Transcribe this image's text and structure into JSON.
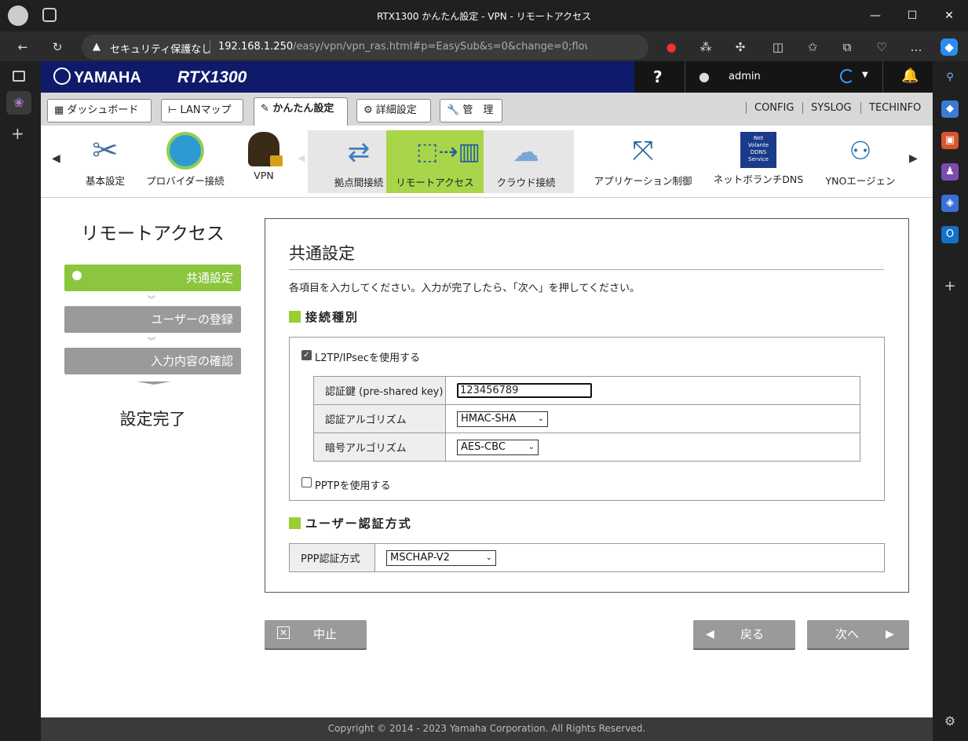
{
  "window": {
    "title": "RTX1300 かんたん設定 - VPN - リモートアクセス",
    "minimize": "—",
    "maximize": "☐",
    "close": "✕"
  },
  "browser": {
    "security_label": "セキュリティ保護なし",
    "url_host": "192.168.1.250",
    "url_path": "/easy/vpn/vpn_ras.html#p=EasySub&s=0&change=0;flow_..."
  },
  "header": {
    "logo": "YAMAHA",
    "model": "RTX1300",
    "help": "?",
    "user": "admin"
  },
  "tabs": [
    {
      "label": "ダッシュボード"
    },
    {
      "label": "LANマップ"
    },
    {
      "label": "かんたん設定"
    },
    {
      "label": "詳細設定"
    },
    {
      "label": "管　理"
    }
  ],
  "top_links": [
    "CONFIG",
    "SYSLOG",
    "TECHINFO"
  ],
  "icon_menu": [
    {
      "label": "基本設定"
    },
    {
      "label": "プロバイダー接続"
    },
    {
      "label": "VPN"
    },
    {
      "label": "拠点間接続"
    },
    {
      "label": "リモートアクセス"
    },
    {
      "label": "クラウド接続"
    },
    {
      "label": "アプリケーション制御"
    },
    {
      "label": "ネットボランチDNS"
    },
    {
      "label": "YNOエージェン"
    }
  ],
  "ddns_text": {
    "line1": "Net",
    "line2": "Volante",
    "line3": "DDNS",
    "line4": "Service"
  },
  "wizard": {
    "title": "リモートアクセス",
    "steps": [
      "共通設定",
      "ユーザーの登録",
      "入力内容の確認"
    ],
    "complete": "設定完了"
  },
  "panel": {
    "heading": "共通設定",
    "instruction": "各項目を入力してください。入力が完了したら、「次へ」を押してください。",
    "section1": "接続種別",
    "l2tp_label": "L2TP/IPsecを使用する",
    "l2tp_checked": true,
    "psk_label": "認証鍵 (pre-shared key)",
    "psk_value": "123456789",
    "auth_algo_label": "認証アルゴリズム",
    "auth_algo_value": "HMAC-SHA",
    "enc_algo_label": "暗号アルゴリズム",
    "enc_algo_value": "AES-CBC",
    "pptp_label": "PPTPを使用する",
    "pptp_checked": false,
    "section2": "ユーザー認証方式",
    "ppp_label": "PPP認証方式",
    "ppp_value": "MSCHAP-V2"
  },
  "buttons": {
    "cancel": "中止",
    "back": "戻る",
    "next": "次へ"
  },
  "footer": "Copyright © 2014 - 2023 Yamaha Corporation. All Rights Reserved.",
  "colors": {
    "accent_green": "#8cc63f",
    "header_blue": "#101a6b",
    "step_gray": "#9a9a9a"
  }
}
